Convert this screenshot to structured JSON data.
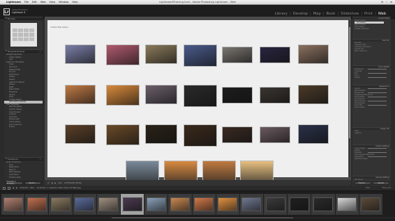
{
  "menubar": {
    "apple": "",
    "app_name": "Lightroom",
    "menus": [
      "File",
      "Edit",
      "Web",
      "View",
      "Window",
      "Help"
    ],
    "window_title": "Lightroom6Training.lrcat - Adobe Photoshop Lightroom - Web"
  },
  "identity": {
    "logo": "Lr",
    "line1": "Adobe Photoshop",
    "line2": "Lightroom 6"
  },
  "modules": [
    "Library",
    "Develop",
    "Map",
    "Book",
    "Slideshow",
    "Print",
    "Web"
  ],
  "module_active": "Web",
  "module_separator": "|",
  "left_panel": {
    "preview_header": "Preview",
    "templates_header": "Template Browser",
    "templates": [
      "Airtight Interactive",
      "Classic Gallery",
      "Grid",
      "Lightroom Templates",
      "Clean",
      "Dark Grid",
      "Default HTML",
      "Fine Art",
      "Earth Tones",
      "Exhibit",
      "Gallery",
      "Lightroom Default",
      "Mosaic",
      "Night",
      "Paper White",
      "Slideshow",
      "Square",
      "Track",
      "Vintage Gallery",
      "Web Gallery Default",
      "User Templates",
      "Web Templates",
      "Custom Gallery",
      "Client Review",
      "Portfolio",
      "Grid Dark",
      "Simple Light",
      "Travel Gallery",
      "Paris Collection",
      "Events"
    ],
    "selected_template": "Web Gallery Default",
    "collections_header": "Collections",
    "collections": [
      "Smart Collections",
      "Paris",
      "Night Shots",
      "Best Of",
      "Web Galleries",
      "Client Work",
      "Portfolio 2015"
    ]
  },
  "left_buttons": [
    "Preview in Browser...",
    "Export..."
  ],
  "main": {
    "gallery_title": "Untitled Web Gallery"
  },
  "main_toolbar": {
    "use_label": "Use:",
    "use_value": "All Filmstrip Photos"
  },
  "right_panel": {
    "layout_style_header": "Layout Style",
    "layout_styles": [
      "Classic Gallery",
      "Grid Gallery",
      "Square Gallery",
      "Track Gallery",
      "Airtight Interactive"
    ],
    "selected_layout": "Grid Gallery",
    "site_info_header": "Site Info",
    "site_info": [
      "Site Title",
      "Collection Title",
      "Collection Description",
      "Contact Info",
      "Web or Mail Link"
    ],
    "color_palette_header": "Color Palette",
    "colors": [
      "Background",
      "Loupe Bg",
      "Text",
      "Icons",
      "Header"
    ],
    "appearance_header": "Appearance",
    "appearance": [
      "Layout",
      "Photo Borders",
      "Display Size",
      "Image Page Background",
      "Show Header",
      "Grid Columns",
      "Photo Shadow",
      "Show Ratings",
      "Show Title",
      "Show Caption"
    ],
    "image_info_header": "Image Info",
    "image_info": [
      "Titles",
      "Captions"
    ],
    "output_settings_header": "Output Settings",
    "output_settings": [
      "Large Images",
      "Quality",
      "Metadata",
      "Add Copyright Watermark",
      "Sharpening",
      "Optimize Images"
    ],
    "upload_settings_header": "Upload Settings",
    "upload_settings": [
      "FTP Server"
    ]
  },
  "right_buttons": [
    "Export...",
    "Upload"
  ],
  "filmstrip": {
    "crumb": "Collection : Paris",
    "count": "32 photos / 1 selected / Notre Dame at Night.jpg",
    "filter_label": "Filter :",
    "filter_value": "Filters Off",
    "selected_index": 5
  },
  "colors": {
    "accent": "#eeeeee",
    "panel": "#333333",
    "stage": "#efefef"
  }
}
